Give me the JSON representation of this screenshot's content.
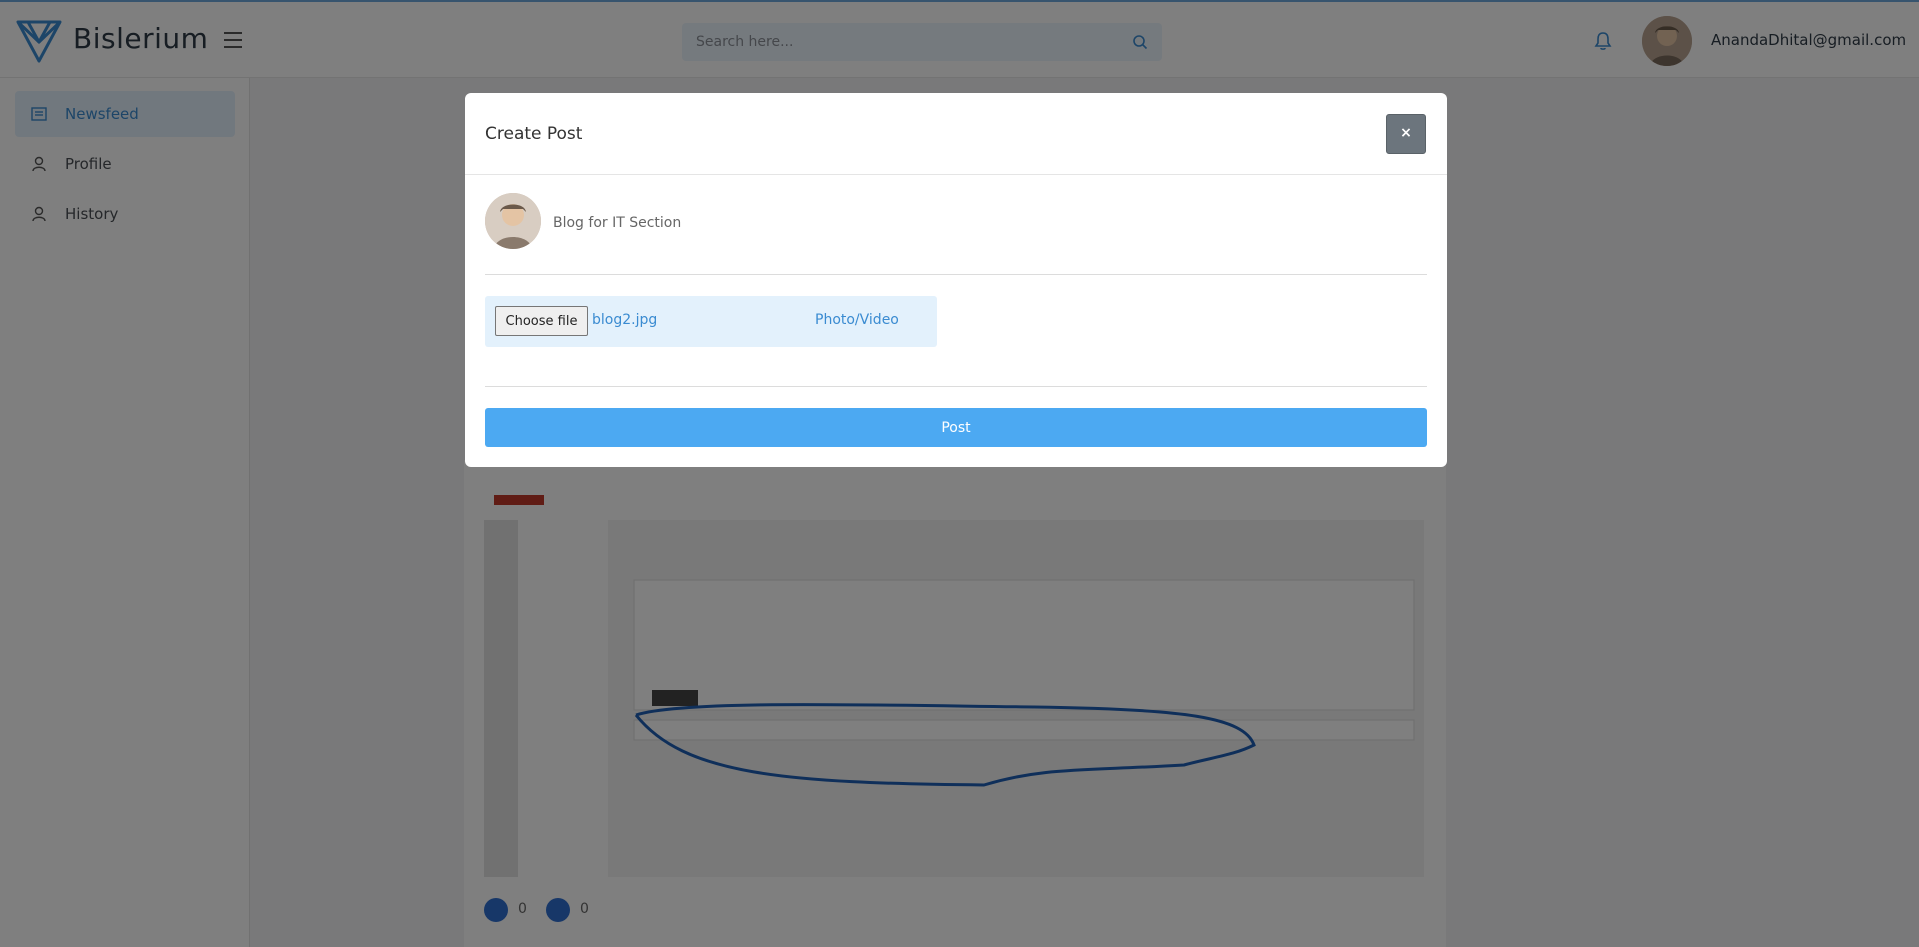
{
  "header": {
    "brand": "Bislerium",
    "search_placeholder": "Search here...",
    "user_email": "AnandaDhital@gmail.com"
  },
  "sidebar": {
    "items": [
      {
        "label": "Newsfeed",
        "icon": "newsfeed-icon",
        "active": true
      },
      {
        "label": "Profile",
        "icon": "user-icon",
        "active": false
      },
      {
        "label": "History",
        "icon": "user-icon",
        "active": false
      }
    ]
  },
  "feed": {
    "likes": "0",
    "dislikes": "0"
  },
  "modal": {
    "title": "Create Post",
    "close_label": "×",
    "post_text": "Blog for IT Section",
    "choose_file_label": "Choose file",
    "file_name": "blog2.jpg",
    "media_label": "Photo/Video",
    "submit_label": "Post"
  },
  "colors": {
    "accent": "#4ca9f2",
    "active_bg": "#e3f1fc",
    "link": "#3a8bd1",
    "close_bg": "#6c757d"
  }
}
